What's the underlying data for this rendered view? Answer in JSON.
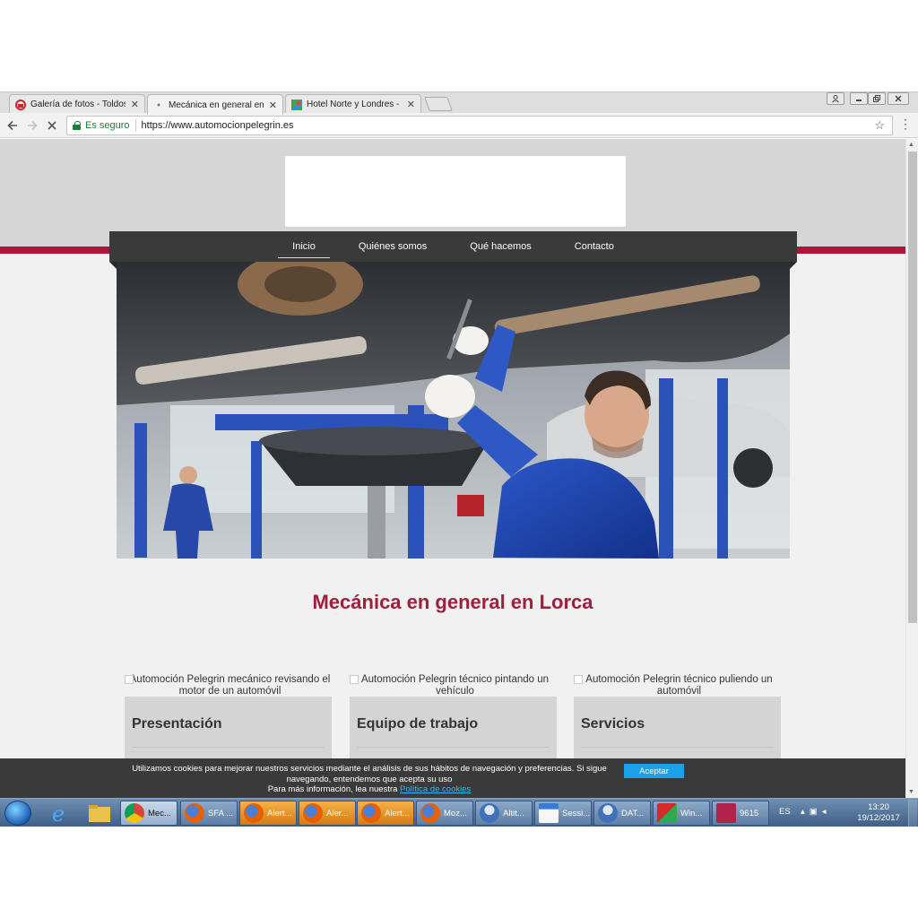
{
  "browser": {
    "tabs": [
      {
        "title": "Galería de fotos - Toldos",
        "icon": "red-logo-icon",
        "active": false
      },
      {
        "title": "Mecánica en general en L",
        "icon": "page-icon",
        "active": true
      },
      {
        "title": "Hotel Norte y Londres -",
        "icon": "maps-icon",
        "active": false
      }
    ],
    "tab_close": "✕",
    "address": {
      "secure_label": "Es seguro",
      "url": "https://www.automocionpelegrin.es"
    }
  },
  "site": {
    "nav": [
      "Inicio",
      "Quiénes somos",
      "Qué hacemos",
      "Contacto"
    ],
    "headline": "Mecánica en general en Lorca",
    "cards": [
      {
        "alt": "Automoción Pelegrin mecánico revisando el motor de un automóvil",
        "title": "Presentación"
      },
      {
        "alt": "Automoción Pelegrin técnico pintando un vehículo",
        "title": "Equipo de trabajo"
      },
      {
        "alt": "Automoción Pelegrin técnico puliendo un automóvil",
        "title": "Servicios"
      }
    ],
    "cookie": {
      "text": "Utilizamos cookies para mejorar nuestros servicios mediante el análisis de sus hábitos de navegación y preferencias. Si sigue navegando, entendemos que acepta su uso",
      "more_prefix": "Para más información, lea nuestra",
      "link": "Política de cookies",
      "accept": "Aceptar"
    },
    "colors": {
      "brand_red": "#b0133a",
      "headline": "#9f1f3f",
      "nav_bg": "#3a3a3a",
      "accept_btn": "#1aa1e9"
    }
  },
  "taskbar": {
    "items": [
      {
        "label": "Mec...",
        "icon": "chrome-icon"
      },
      {
        "label": "SFA ...",
        "icon": "firefox-icon"
      },
      {
        "label": "Alert...",
        "icon": "firefox-icon"
      },
      {
        "label": "Aler...",
        "icon": "firefox-icon"
      },
      {
        "label": "Alert...",
        "icon": "firefox-icon"
      },
      {
        "label": "Moz...",
        "icon": "firefox-icon"
      },
      {
        "label": "Altit...",
        "icon": "users-icon"
      },
      {
        "label": "Sessi...",
        "icon": "window-icon"
      },
      {
        "label": "DAT...",
        "icon": "users-icon"
      },
      {
        "label": "Win...",
        "icon": "app-icon"
      },
      {
        "label": "9615",
        "icon": "access-icon"
      }
    ],
    "lang": "ES",
    "time": "13:20",
    "date": "19/12/2017"
  }
}
